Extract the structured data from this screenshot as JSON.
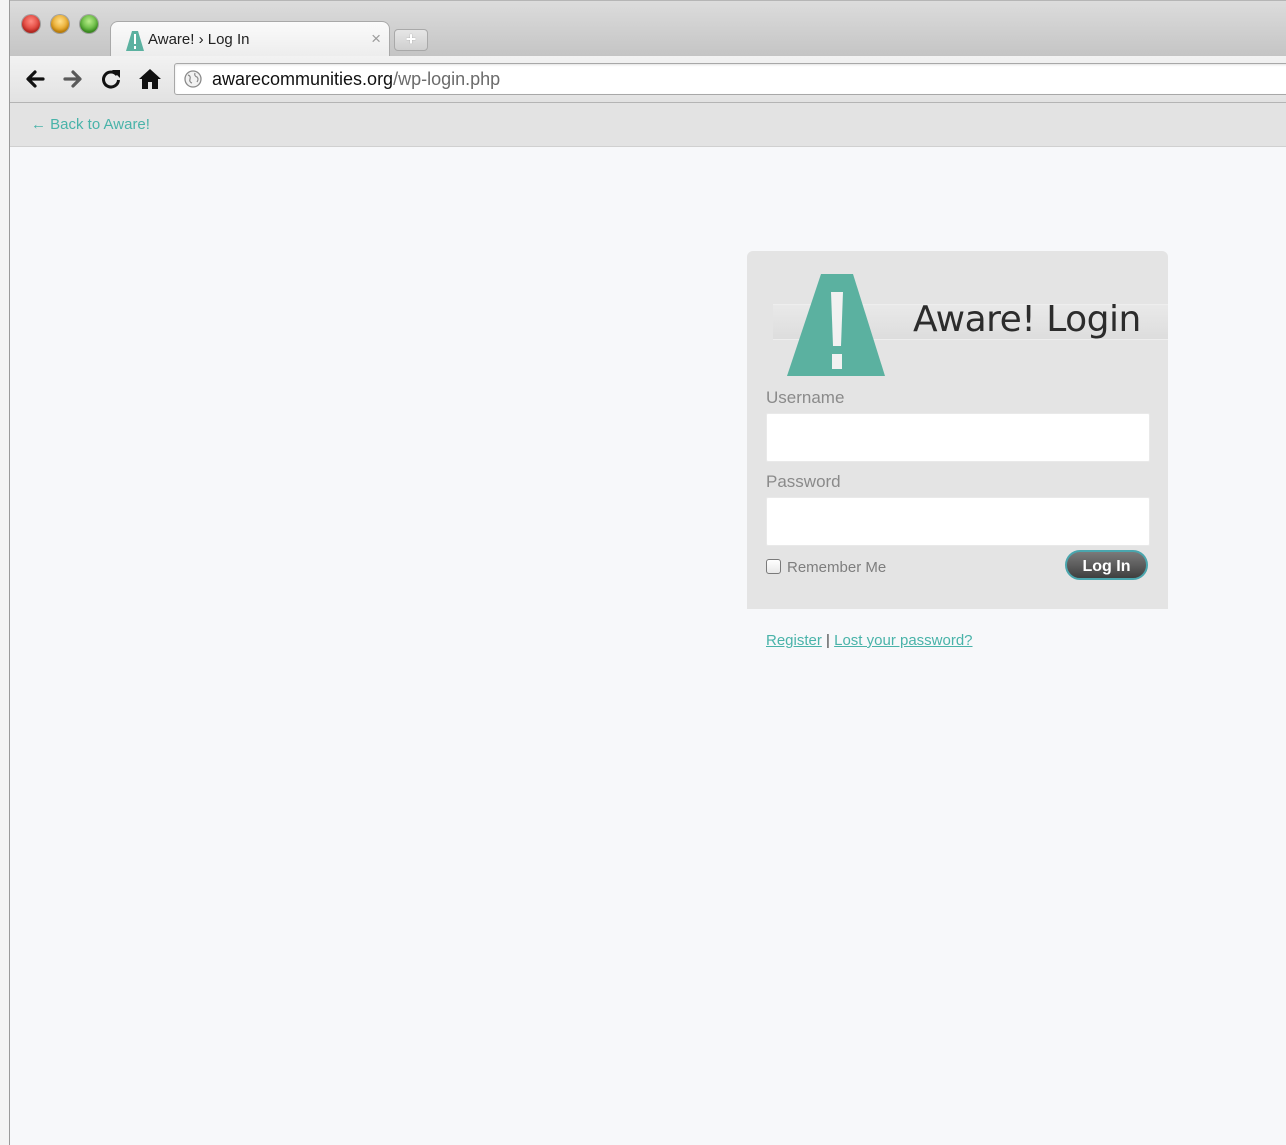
{
  "browser": {
    "tab_title": "Aware! › Log In",
    "tab_close_glyph": "×",
    "new_tab_glyph": "+",
    "url_domain": "awarecommunities.org",
    "url_path": "/wp-login.php"
  },
  "site": {
    "back_link": "← Back to Aware!"
  },
  "login": {
    "title": "Aware! Login",
    "username_label": "Username",
    "password_label": "Password",
    "username_value": "",
    "password_value": "",
    "remember_label": "Remember Me",
    "remember_checked": false,
    "submit_label": "Log In",
    "register_link": "Register",
    "separator": "|",
    "lost_password_link": "Lost your password?"
  },
  "colors": {
    "accent_teal": "#49b3a9",
    "logo_teal": "#5bb1a0",
    "panel_gray": "#e4e4e4"
  },
  "icons": [
    "close-window-icon",
    "minimize-window-icon",
    "maximize-window-icon",
    "aware-favicon-icon",
    "back-arrow-icon",
    "forward-arrow-icon",
    "reload-icon",
    "home-icon",
    "globe-icon",
    "aware-logo-icon"
  ]
}
